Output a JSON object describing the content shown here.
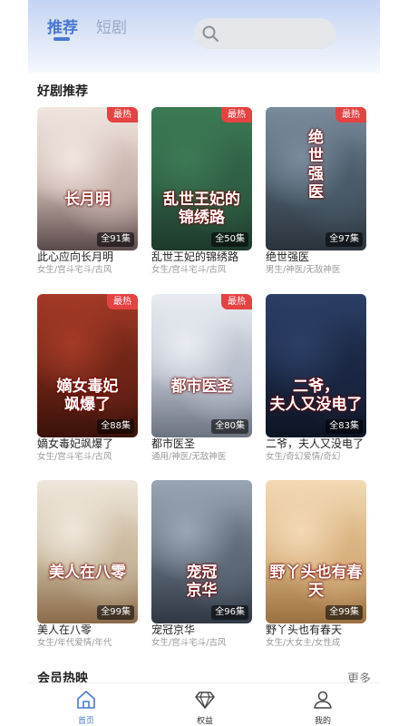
{
  "header": {
    "tabs": [
      {
        "label": "推荐",
        "active": true
      },
      {
        "label": "短剧",
        "active": false
      }
    ],
    "search": {
      "placeholder": ""
    }
  },
  "sections": {
    "recommended": {
      "title": "好剧推荐"
    },
    "member": {
      "title": "会员热映",
      "more_label": "更多"
    }
  },
  "cards": [
    {
      "title": "此心应向长月明",
      "tags": "女生/宫斗宅斗/古风",
      "badge": "最热",
      "episodes": "全91集",
      "poster_text": "长月明",
      "colors": [
        "#f1e5df",
        "#c9b4ad",
        "#5a4a4a"
      ]
    },
    {
      "title": "乱世王妃的锦绣路",
      "tags": "女生/宫斗宅斗/古风",
      "badge": "最热",
      "episodes": "全50集",
      "poster_text": "乱世王妃的\n锦绣路",
      "colors": [
        "#3c7a55",
        "#2f5f44",
        "#1e3a2c"
      ]
    },
    {
      "title": "绝世强医",
      "tags": "男生/神医/无敌神医",
      "badge": "最热",
      "episodes": "全97集",
      "poster_text": "绝\n世\n强\n医",
      "colors": [
        "#7a8c9c",
        "#4a5a68",
        "#2a333c"
      ]
    },
    {
      "title": "嫡女毒妃飒爆了",
      "tags": "女生/宫斗宅斗/古风",
      "badge": "最热",
      "episodes": "全88集",
      "poster_text": "嫡女毒妃\n飒爆了",
      "colors": [
        "#a33a26",
        "#6e2416",
        "#3a120a"
      ]
    },
    {
      "title": "都市医圣",
      "tags": "通用/神医/无敌神医",
      "badge": "最热",
      "episodes": "全80集",
      "poster_text": "都市医圣",
      "colors": [
        "#e9ecf2",
        "#b9bfcc",
        "#6b7280"
      ]
    },
    {
      "title": "二爷，夫人又没电了",
      "tags": "女生/奇幻爱情/奇幻",
      "badge": "",
      "episodes": "全83集",
      "poster_text": "二爷，\n夫人又没电了",
      "colors": [
        "#2b3f66",
        "#1b2742",
        "#0d1424"
      ]
    },
    {
      "title": "美人在八零",
      "tags": "女生/年代爱情/年代",
      "badge": "",
      "episodes": "全99集",
      "poster_text": "美人在八零",
      "colors": [
        "#efe7dc",
        "#c9b89c",
        "#8a6a4a"
      ]
    },
    {
      "title": "宠冠京华",
      "tags": "女生/宫斗宅斗/古风",
      "badge": "",
      "episodes": "全96集",
      "poster_text": "宠冠\n京华",
      "colors": [
        "#9aa6b4",
        "#5e6a78",
        "#303844"
      ]
    },
    {
      "title": "野丫头也有春天",
      "tags": "女生/大女主/女性成",
      "badge": "",
      "episodes": "全99集",
      "poster_text": "野丫头也有春天",
      "colors": [
        "#f2d9b4",
        "#d8b07e",
        "#9a7040"
      ]
    }
  ],
  "tabbar": {
    "items": [
      {
        "label": "首页",
        "icon": "home-icon",
        "active": true
      },
      {
        "label": "权益",
        "icon": "diamond-icon",
        "active": false
      },
      {
        "label": "我的",
        "icon": "profile-icon",
        "active": false
      }
    ]
  },
  "colors": {
    "accent": "#4a78d0",
    "badge": "#e54242",
    "header_gradient_top": "#c4d3f3"
  }
}
